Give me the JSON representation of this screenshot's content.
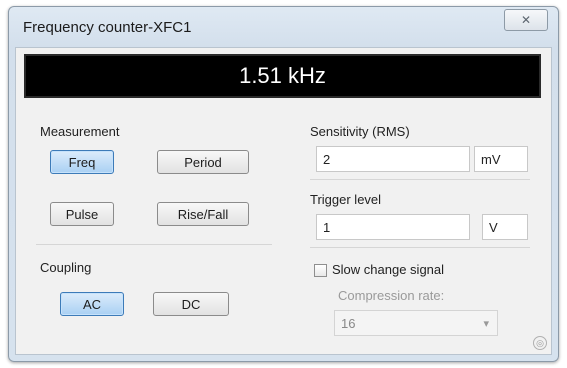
{
  "window": {
    "title": "Frequency counter-XFC1",
    "close_label": "✕"
  },
  "display": {
    "reading": "1.51 kHz"
  },
  "measurement": {
    "heading": "Measurement",
    "buttons": [
      {
        "label": "Freq",
        "active": true
      },
      {
        "label": "Period",
        "active": false
      },
      {
        "label": "Pulse",
        "active": false
      },
      {
        "label": "Rise/Fall",
        "active": false
      }
    ]
  },
  "coupling": {
    "heading": "Coupling",
    "buttons": [
      {
        "label": "AC",
        "active": true
      },
      {
        "label": "DC",
        "active": false
      }
    ]
  },
  "sensitivity": {
    "heading": "Sensitivity (RMS)",
    "value": "2",
    "unit": "mV"
  },
  "trigger": {
    "heading": "Trigger level",
    "value": "1",
    "unit": "V"
  },
  "slow_change": {
    "label": "Slow change signal",
    "checked": false
  },
  "compression": {
    "label": "Compression rate:",
    "value": "16",
    "arrow": "▾"
  },
  "colors": {
    "active_button": "#a9d0f3",
    "display_bg": "#000000",
    "display_text": "#ffffff"
  }
}
